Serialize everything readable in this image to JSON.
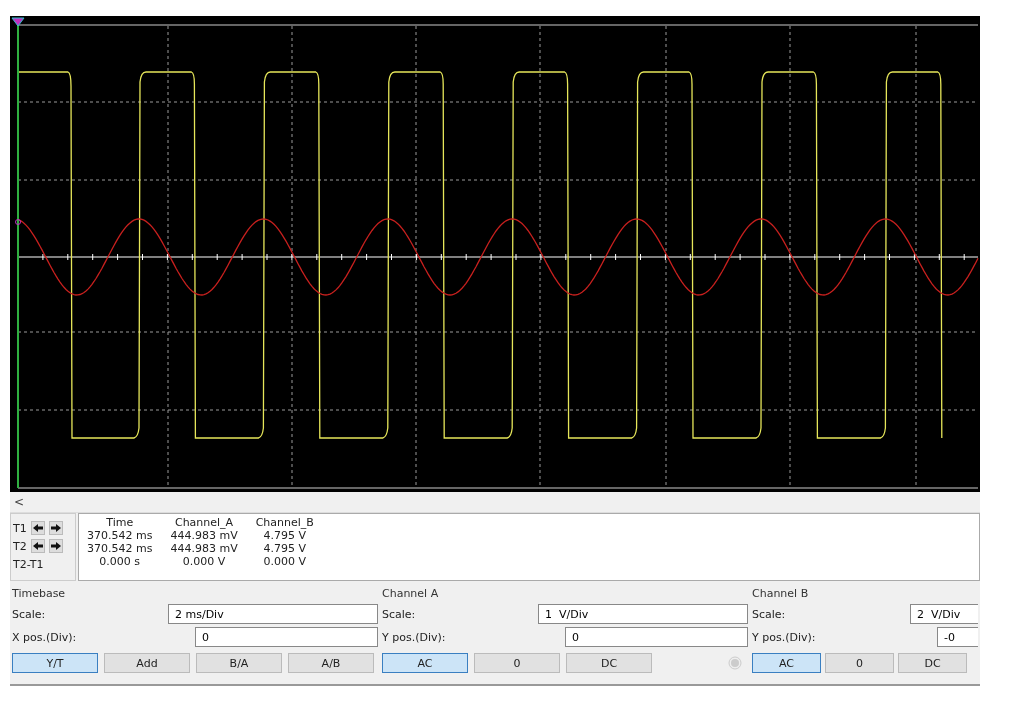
{
  "scroll_left": "<",
  "cursors": [
    {
      "label": "T1",
      "kind": "cursor"
    },
    {
      "label": "T2",
      "kind": "cursor"
    },
    {
      "label": "T2-T1",
      "kind": "difference"
    }
  ],
  "readout": {
    "columns": [
      "Time",
      "Channel_A",
      "Channel_B"
    ],
    "rows": [
      [
        "370.542 ms",
        "444.983 mV",
        "4.795 V"
      ],
      [
        "370.542 ms",
        "444.983 mV",
        "4.795 V"
      ],
      [
        "0.000 s",
        "0.000 V",
        "0.000 V"
      ]
    ]
  },
  "groups": [
    {
      "title": "Timebase",
      "kind": "timebase",
      "fields": [
        {
          "label": "Scale:",
          "value": "2 ms/Div"
        },
        {
          "label": "X pos.(Div):",
          "value": "0"
        }
      ],
      "buttons": [
        {
          "label": "Y/T",
          "selected": true
        },
        {
          "label": "Add",
          "selected": false
        },
        {
          "label": "B/A",
          "selected": false
        },
        {
          "label": "A/B",
          "selected": false
        }
      ]
    },
    {
      "title": "Channel A",
      "kind": "channel",
      "fields": [
        {
          "label": "Scale:",
          "value": "1  V/Div"
        },
        {
          "label": "Y pos.(Div):",
          "value": "0"
        }
      ],
      "buttons": [
        {
          "label": "AC",
          "selected": true
        },
        {
          "label": "0",
          "selected": false
        },
        {
          "label": "DC",
          "selected": false
        }
      ]
    },
    {
      "title": "Channel B",
      "kind": "channel",
      "fields": [
        {
          "label": "Scale:",
          "value": "2  V/Div"
        },
        {
          "label": "Y pos.(Div):",
          "value": "-0"
        }
      ],
      "buttons": [
        {
          "label": "AC",
          "selected": true
        },
        {
          "label": "0",
          "selected": false
        },
        {
          "label": "DC",
          "selected": false
        }
      ]
    }
  ]
}
